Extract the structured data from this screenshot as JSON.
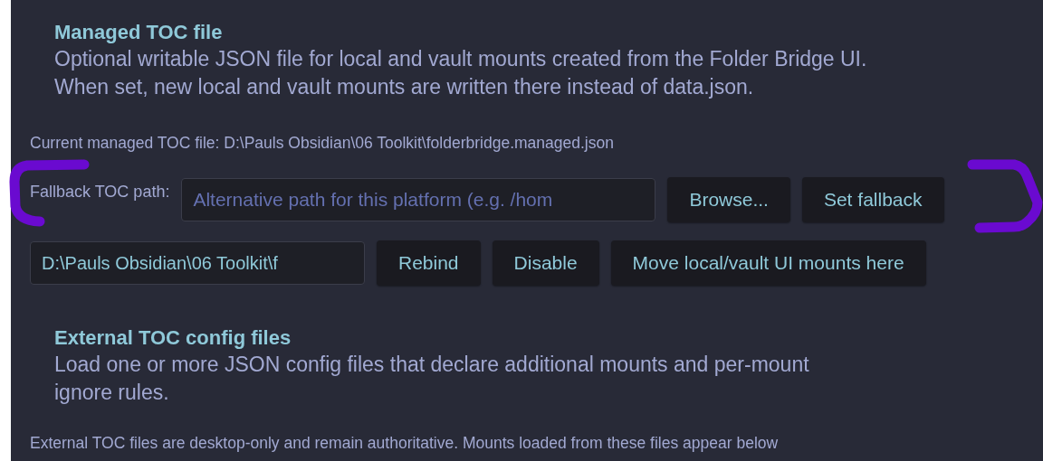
{
  "sections": [
    {
      "title": "Managed TOC file",
      "description": [
        "Optional writable JSON file for local and vault mounts created from the Folder Bridge UI.",
        "When set, new local and vault mounts are written there instead of data.json."
      ],
      "note": "Current managed TOC file: D:\\Pauls Obsidian\\06 Toolkit\\folderbridge.managed.json",
      "rows": [
        {
          "bracketed": true,
          "label": "Fallback TOC path:",
          "field": {
            "placeholder": "Alternative path for this platform (e.g. /hom"
          },
          "buttons": [
            "Browse...",
            "Set fallback"
          ]
        },
        {
          "bracketed": false,
          "field": {
            "value": "D:\\Pauls Obsidian\\06 Toolkit\\f"
          },
          "buttons": [
            "Rebind",
            "Disable",
            "Move local/vault UI mounts here"
          ]
        }
      ]
    },
    {
      "title": "External TOC config files",
      "description": [
        "Load one or more JSON config files that declare additional mounts and per-mount ignore rules."
      ],
      "note": "External TOC files are desktop-only and remain authoritative. Mounts loaded from these files appear below"
    }
  ]
}
